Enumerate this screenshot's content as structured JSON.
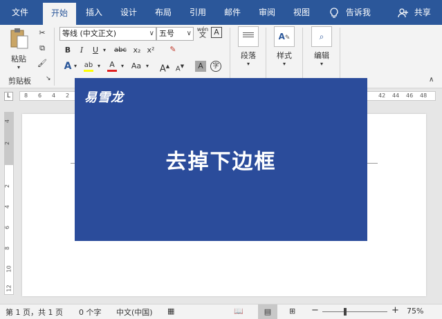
{
  "tabs": [
    {
      "label": "文件",
      "left": 0
    },
    {
      "label": "开始",
      "left": 0
    },
    {
      "label": "插入"
    },
    {
      "label": "设计"
    },
    {
      "label": "布局"
    },
    {
      "label": "引用"
    },
    {
      "label": "邮件"
    },
    {
      "label": "审阅"
    },
    {
      "label": "视图"
    }
  ],
  "tellme": "告诉我",
  "share": "共享",
  "clipboard": {
    "paste_label": "粘贴",
    "group_label": "剪贴板"
  },
  "font": {
    "font_name": "等线 (中文正文)",
    "font_size": "五号",
    "bold": "B",
    "italic": "I",
    "underline": "U",
    "strike": "abc",
    "subscript": "x₂",
    "superscript": "x²",
    "grow": "A",
    "shrink": "A",
    "case": "Aa",
    "phonetic_top": "wén",
    "phonetic_bottom": "文",
    "border_char": "A",
    "highlight_char": "ab",
    "fontcolor_char": "A",
    "texteffect_char": "A",
    "shading_char": "A",
    "enclose_char": "字"
  },
  "paragraph": {
    "label": "段落"
  },
  "styles": {
    "label": "样式"
  },
  "editing": {
    "label": "编辑"
  },
  "ruler": {
    "h_ticks": [
      "8",
      "6",
      "4",
      "2",
      "42",
      "44",
      "46",
      "48"
    ],
    "v_ticks": [
      "4",
      "2",
      "2",
      "4",
      "6",
      "8",
      "10",
      "12"
    ]
  },
  "overlay": {
    "logo": "易雪龙",
    "title": "去掉下边框"
  },
  "status": {
    "page": "第 1 页，共 1 页",
    "words": "0 个字",
    "language": "中文(中国)",
    "zoom": "75%",
    "zoom_minus": "−",
    "zoom_plus": "+"
  },
  "colors": {
    "brand": "#2b579a",
    "overlay": "#2b4c9b",
    "highlight": "#ffff00",
    "fontcolor": "#e02020"
  }
}
